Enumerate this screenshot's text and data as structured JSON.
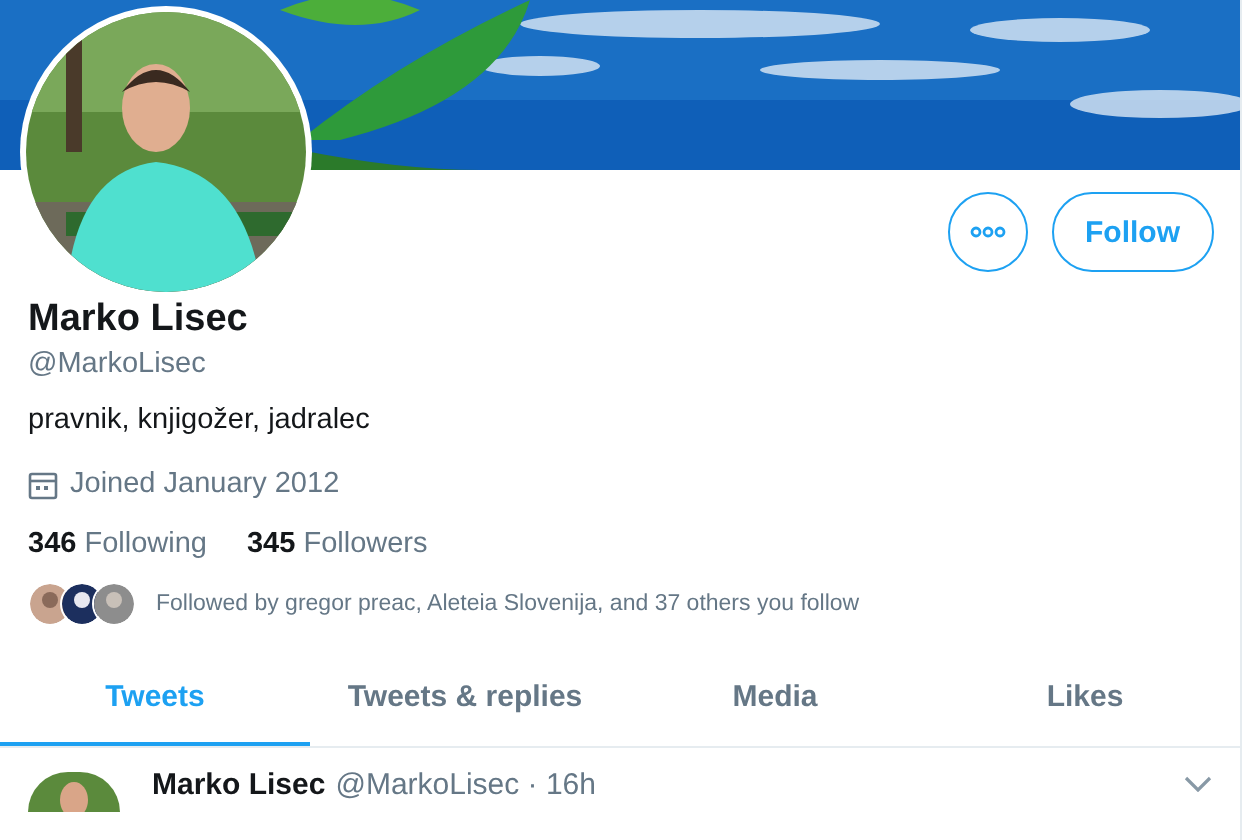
{
  "profile": {
    "name": "Marko Lisec",
    "handle": "@MarkoLisec",
    "bio": "pravnik, knjigožer, jadralec",
    "joined": "Joined January 2012"
  },
  "actions": {
    "follow": "Follow"
  },
  "stats": [
    {
      "count": "346",
      "label": "Following"
    },
    {
      "count": "345",
      "label": "Followers"
    }
  ],
  "followed_by": "Followed by gregor preac, Aleteia Slovenija, and 37 others you follow",
  "tabs": [
    {
      "label": "Tweets",
      "selected": true
    },
    {
      "label": "Tweets & replies",
      "selected": false
    },
    {
      "label": "Media",
      "selected": false
    },
    {
      "label": "Likes",
      "selected": false
    }
  ],
  "tweet": {
    "name": "Marko Lisec",
    "handle": "@MarkoLisec",
    "separator": "·",
    "time": "16h"
  }
}
